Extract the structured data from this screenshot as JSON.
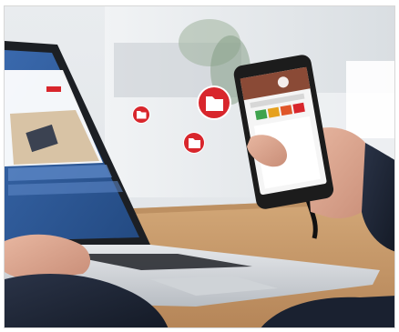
{
  "scene": {
    "description_colors": {
      "accent_red": "#d8262c",
      "laptop_screen_blue": "#2f5d9e",
      "sweater_navy": "#1d2433",
      "phone_dark": "#1c1c1c",
      "table_wood": "#c29466"
    },
    "icons": [
      "folder-icon",
      "folder-icon",
      "folder-icon",
      "folder-icon"
    ]
  }
}
